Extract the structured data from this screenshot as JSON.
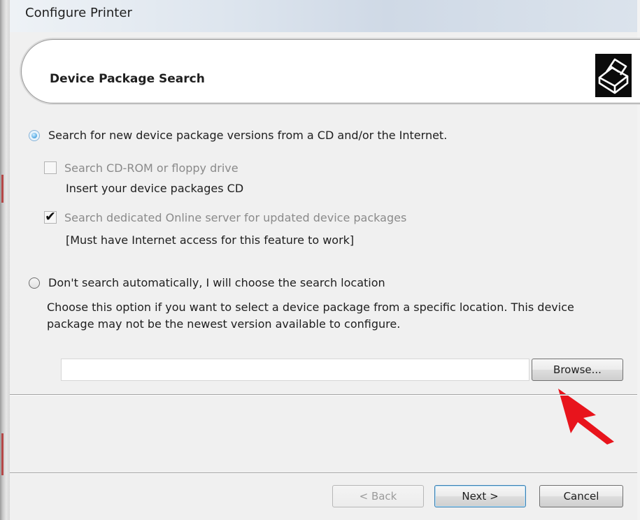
{
  "window": {
    "title": "Configure Printer"
  },
  "header": {
    "title": "Device Package Search",
    "icon": "printer-icon"
  },
  "options": {
    "search_new": {
      "label": "Search for new device package versions from a CD and/or the Internet.",
      "selected": true
    },
    "search_cdrom": {
      "label": "Search CD-ROM or floppy drive",
      "hint": "Insert your device packages CD",
      "checked": false,
      "enabled": false
    },
    "search_online": {
      "label": "Search dedicated Online server for updated device packages",
      "hint": "[Must have Internet access for this feature to work]",
      "checked": true,
      "enabled": false
    },
    "manual": {
      "label": "Don't search automatically, I will choose the search location",
      "description_line1": "Choose this option if you want to select a device package from a specific location. This device",
      "description_line2": "package may not be the newest version available to configure.",
      "selected": false
    }
  },
  "location": {
    "value": "",
    "browse_label": "Browse..."
  },
  "footer": {
    "back_label": "< Back",
    "next_label": "Next >",
    "cancel_label": "Cancel"
  },
  "colors": {
    "dialog_background": "#f0f0f0",
    "annotation_arrow": "#e8141c",
    "default_button_border": "#3c7fb1"
  }
}
